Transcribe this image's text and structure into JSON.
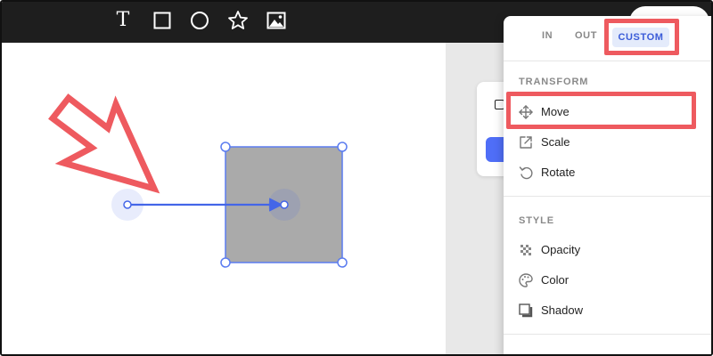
{
  "toolbar": {
    "tools": [
      {
        "name": "text-tool",
        "icon": "text-icon",
        "glyph": "T"
      },
      {
        "name": "rectangle-tool",
        "icon": "square-icon"
      },
      {
        "name": "circle-tool",
        "icon": "circle-icon"
      },
      {
        "name": "star-tool",
        "icon": "star-icon"
      },
      {
        "name": "image-tool",
        "icon": "image-icon"
      }
    ]
  },
  "animation_menu": {
    "tabs": {
      "in_label": "IN",
      "out_label": "OUT",
      "custom_label": "CUSTOM",
      "active": "CUSTOM"
    },
    "transform": {
      "heading": "TRANSFORM",
      "items": [
        {
          "label": "Move",
          "icon": "move-icon"
        },
        {
          "label": "Scale",
          "icon": "scale-icon"
        },
        {
          "label": "Rotate",
          "icon": "rotate-icon"
        }
      ]
    },
    "style": {
      "heading": "STYLE",
      "items": [
        {
          "label": "Opacity",
          "icon": "opacity-icon"
        },
        {
          "label": "Color",
          "icon": "palette-icon"
        },
        {
          "label": "Shadow",
          "icon": "shadow-icon"
        }
      ]
    }
  },
  "colors": {
    "toolbar_bg": "#1e1e1e",
    "accent": "#4f6ef7",
    "highlight": "#ee5a5f",
    "shape_fill": "#aaaaaa",
    "selection": "#5b7cf0"
  }
}
